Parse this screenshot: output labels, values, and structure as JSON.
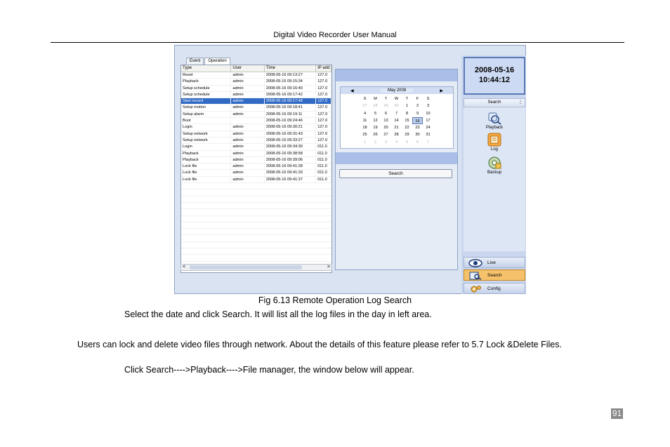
{
  "page": {
    "header": "Digital Video Recorder User Manual",
    "caption": "Fig 6.13 Remote Operation Log Search",
    "paragraph1": "Select the date and click Search. It will list all the log files in the day in left area.",
    "paragraph2": "Users can lock and delete video files through network. About the details of this feature please refer to 5.7 Lock &Delete Files.",
    "paragraph3": "Click Search---->Playback---->File manager, the window below will appear.",
    "page_number": "91"
  },
  "screenshot": {
    "tabs": [
      "Event",
      "Operation"
    ],
    "columns": [
      "Type",
      "User",
      "Time",
      "IP add"
    ],
    "rows": [
      [
        "Reset",
        "admin",
        "2008-05-16 09:13:27",
        "127.0"
      ],
      [
        "Playback",
        "admin",
        "2008-05-16 09:15:34",
        "127.0"
      ],
      [
        "Setup schedule",
        "admin",
        "2008-05-16 09:16:40",
        "127.0"
      ],
      [
        "Setup schedule",
        "admin",
        "2008-05-16 09:17:42",
        "127.0"
      ],
      [
        "Start record",
        "admin",
        "2008-05-16 09:17:48",
        "127.0"
      ],
      [
        "Setup motion",
        "admin",
        "2008-05-16 09:18:41",
        "127.0"
      ],
      [
        "Setup alarm",
        "admin",
        "2008-05-16 09:19:11",
        "127.0"
      ],
      [
        "Boot",
        "",
        "2008-05-16 09:24:46",
        "127.0"
      ],
      [
        "Login",
        "admin",
        "2008-05-16 09:30:21",
        "127.0"
      ],
      [
        "Setup network",
        "admin",
        "2008-05-16 09:31:43",
        "127.0"
      ],
      [
        "Setup network",
        "admin",
        "2008-05-16 09:33:27",
        "127.0"
      ],
      [
        "Login",
        "admin",
        "2008-05-16 09:34:30",
        "011.0"
      ],
      [
        "Playback",
        "admin",
        "2008-05-16 09:38:58",
        "011.0"
      ],
      [
        "Playback",
        "admin",
        "2008-05-16 09:39:06",
        "011.0"
      ],
      [
        "Lock file",
        "admin",
        "2008-05-16 09:41:28",
        "011.0"
      ],
      [
        "Lock file",
        "admin",
        "2008-05-16 09:41:33",
        "011.0"
      ],
      [
        "Lock file",
        "admin",
        "2008-05-16 09:41:37",
        "011.0"
      ]
    ],
    "selected_row": 4,
    "calendar": {
      "month_label": "May 2008",
      "prev": "◀",
      "next": "▶",
      "weekdays": [
        "S",
        "M",
        "T",
        "W",
        "T",
        "F",
        "S"
      ],
      "weeks": [
        [
          "27",
          "28",
          "29",
          "30",
          "1",
          "2",
          "3"
        ],
        [
          "4",
          "5",
          "6",
          "7",
          "8",
          "9",
          "10"
        ],
        [
          "11",
          "12",
          "13",
          "14",
          "15",
          "16",
          "17"
        ],
        [
          "18",
          "19",
          "20",
          "21",
          "22",
          "23",
          "24"
        ],
        [
          "25",
          "26",
          "27",
          "28",
          "29",
          "30",
          "31"
        ],
        [
          "1",
          "2",
          "3",
          "4",
          "5",
          "6",
          "7"
        ]
      ],
      "selected_day": "16"
    },
    "search_button": "Search",
    "clock_date": "2008-05-16",
    "clock_time": "10:44:12",
    "side_header": "Search",
    "side_icons": [
      "Playback",
      "Log",
      "Backup"
    ],
    "nav": [
      "Live",
      "Search",
      "Config"
    ],
    "active_nav": "Search",
    "scroll_left": "<",
    "scroll_right": ">"
  }
}
